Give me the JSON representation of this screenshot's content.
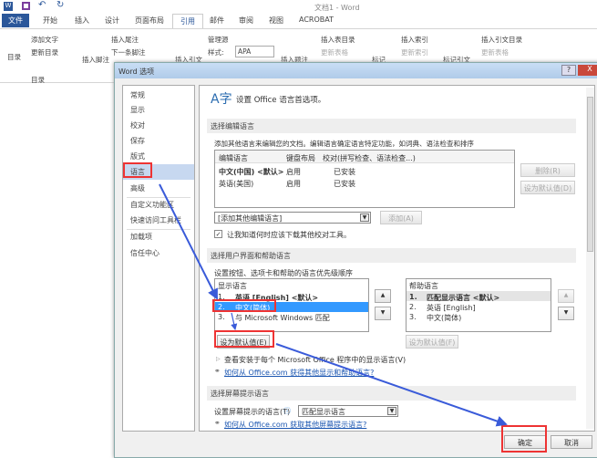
{
  "window": {
    "title": "文档1 - Word"
  },
  "tabs": [
    "文件",
    "开始",
    "插入",
    "设计",
    "页面布局",
    "引用",
    "邮件",
    "审阅",
    "视图",
    "ACROBAT"
  ],
  "ribbon": {
    "toc": "目录",
    "add_text": "添加文字",
    "update_toc": "更新目录",
    "group_toc": "目录",
    "insert_footnote": "插入脚注",
    "insert_endnote": "插入尾注",
    "next_footnote": "下一条脚注",
    "insert_citation": "插入引文",
    "manage_sources": "管理源",
    "style_label": "样式:",
    "style_value": "APA",
    "insert_caption": "插入题注",
    "insert_tof": "插入表目录",
    "update_table": "更新表格",
    "mark_entry": "标记",
    "insert_index": "插入索引",
    "update_index": "更新索引",
    "mark_citation": "标记引文",
    "insert_toa": "插入引文目录",
    "update_toa": "更新表格"
  },
  "dialog": {
    "title": "Word 选项",
    "help": "?",
    "close": "X",
    "nav": [
      "常规",
      "显示",
      "校对",
      "保存",
      "版式",
      "语言",
      "高级",
      "自定义功能区",
      "快速访问工具栏",
      "加载项",
      "信任中心"
    ],
    "heading": "设置 Office 语言首选项。",
    "edit": {
      "section": "选择编辑语言",
      "desc": "添加其他语言来编辑您的文档。编辑语言确定语言特定功能，如词典、语法检查和排序",
      "columns": [
        "编辑语言",
        "键盘布局",
        "校对(拼写检查、语法检查...)"
      ],
      "rows": [
        [
          "中文(中国) <默认>",
          "启用",
          "已安装"
        ],
        [
          "英语(美国)",
          "启用",
          "已安装"
        ]
      ],
      "remove": "删除(R)",
      "set_default": "设为默认值(D)",
      "add_dropdown": "[添加其他编辑语言]",
      "add": "添加(A)",
      "checkbox": "让我知道何时应该下载其他校对工具。"
    },
    "ui": {
      "section": "选择用户界面和帮助语言",
      "desc": "设置按钮、选项卡和帮助的语言优先级顺序",
      "display_header": "显示语言",
      "display": [
        [
          "1.",
          "英语 [English] <默认>"
        ],
        [
          "2.",
          "中文(简体)"
        ],
        [
          "3.",
          "与 Microsoft Windows 匹配"
        ]
      ],
      "help_header": "帮助语言",
      "help": [
        [
          "1.",
          "匹配显示语言 <默认>"
        ],
        [
          "2.",
          "英语 [English]"
        ],
        [
          "3.",
          "中文(简体)"
        ]
      ],
      "set_default_display": "设为默认值(E)",
      "set_default_help": "设为默认值(F)",
      "view_installed": "查看安装于每个 Microsoft Office 程序中的显示语言(V)",
      "link": "如何从 Office.com 获得其他显示和帮助语言?"
    },
    "tip": {
      "section": "选择屏幕提示语言",
      "label": "设置屏幕提示的语言(T)",
      "value": "匹配显示语言",
      "link": "如何从 Office.com 获取其他屏幕提示语言?"
    },
    "ok": "确定",
    "cancel": "取消"
  }
}
